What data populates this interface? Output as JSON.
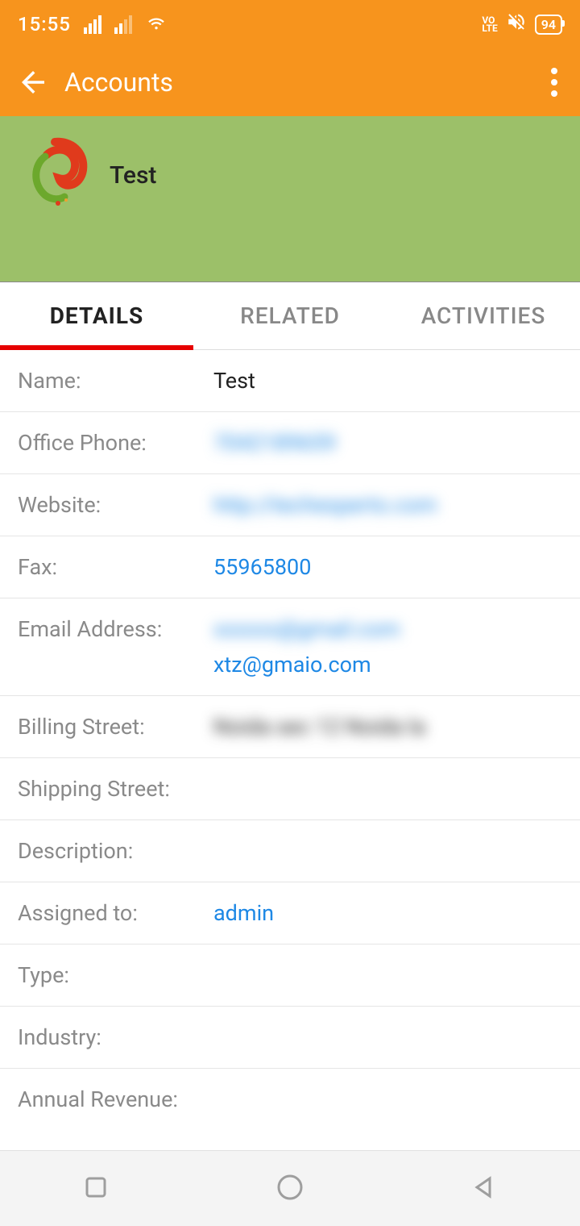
{
  "status": {
    "time": "15:55",
    "volte_top": "VO",
    "volte_bottom": "LTE",
    "battery": "94"
  },
  "appbar": {
    "title": "Accounts"
  },
  "hero": {
    "title": "Test"
  },
  "tabs": {
    "details": "DETAILS",
    "related": "RELATED",
    "activities": "ACTIVITIES"
  },
  "fields": {
    "name_label": "Name:",
    "name_value": "Test",
    "office_phone_label": "Office Phone:",
    "office_phone_value": "7042189659",
    "website_label": "Website:",
    "website_value": "http://techesperto.com",
    "fax_label": "Fax:",
    "fax_value": "55965800",
    "email_label": "Email Address:",
    "email_value_blur": "xxxxxx@gmail.com",
    "email_value2": "xtz@gmaio.com",
    "billing_street_label": "Billing Street:",
    "billing_street_value": "Noida sec 12 Noida la",
    "shipping_street_label": "Shipping Street:",
    "shipping_street_value": "",
    "description_label": "Description:",
    "description_value": "",
    "assigned_to_label": "Assigned to:",
    "assigned_to_value": "admin",
    "type_label": "Type:",
    "type_value": "",
    "industry_label": "Industry:",
    "industry_value": "",
    "annual_revenue_label": "Annual Revenue:",
    "annual_revenue_value": ""
  }
}
